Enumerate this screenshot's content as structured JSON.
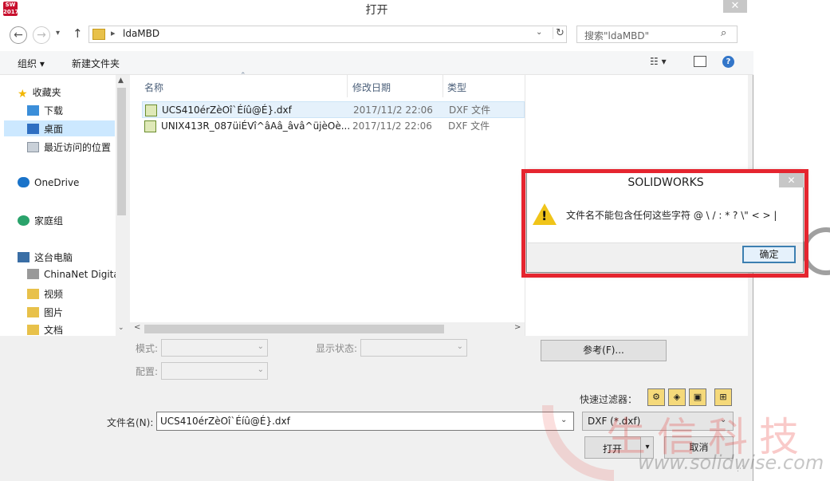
{
  "window": {
    "app_badge": "SW 2017",
    "title": "打开",
    "close": "✕"
  },
  "nav": {
    "back": "←",
    "forward": "→",
    "recent": "▾",
    "up": "↑"
  },
  "address": {
    "separator": "▸",
    "path": "ldaMBD",
    "drop": "⌄",
    "refresh": "↻"
  },
  "search": {
    "placeholder": "搜索\"ldaMBD\"",
    "icon": "⌕"
  },
  "toolbar": {
    "organize": "组织 ▾",
    "new_folder": "新建文件夹",
    "view": "☷ ▾",
    "help": "?"
  },
  "sidebar": {
    "items": [
      {
        "label": "收藏夹",
        "icon": "star-icon",
        "color": "#f2b600"
      },
      {
        "label": "下载",
        "icon": "download-icon",
        "color": "#3b8ed9"
      },
      {
        "label": "桌面",
        "icon": "desktop-icon",
        "color": "#2f6fc2"
      },
      {
        "label": "最近访问的位置",
        "icon": "recent-places-icon",
        "color": "#9aa4b0"
      },
      {
        "label": "OneDrive",
        "icon": "cloud-icon",
        "color": "#1a73c9"
      },
      {
        "label": "家庭组",
        "icon": "homegroup-icon",
        "color": "#2aa36b"
      },
      {
        "label": "这台电脑",
        "icon": "computer-icon",
        "color": "#3a6ea5"
      },
      {
        "label": "ChinaNet Digita",
        "icon": "network-device-icon",
        "color": "#777777"
      },
      {
        "label": "视频",
        "icon": "videos-folder-icon",
        "color": "#e8c14a"
      },
      {
        "label": "图片",
        "icon": "pictures-folder-icon",
        "color": "#e8c14a"
      },
      {
        "label": "文档",
        "icon": "documents-folder-icon",
        "color": "#e8c14a"
      }
    ],
    "scroll_up": "▲",
    "scroll_down": "⌄"
  },
  "files": {
    "columns": [
      "名称",
      "修改日期",
      "类型"
    ],
    "sort_arrow": "⌃",
    "rows": [
      {
        "name": "UCS410érZèOî`Éíû@É}.dxf",
        "date": "2017/11/2 22:06",
        "type": "DXF 文件"
      },
      {
        "name": "UNIX413R_087üiÉVî^âAâ_âvâ^üjèOè...",
        "date": "2017/11/2 22:06",
        "type": "DXF 文件"
      }
    ],
    "scroll_left": "<",
    "scroll_right": ">"
  },
  "options": {
    "mode_label": "模式:",
    "display_state_label": "显示状态:",
    "config_label": "配置:",
    "combo_arrow": "⌄",
    "reference_button": "参考(F)...",
    "quick_filter_label": "快速过滤器：",
    "quick_filters": [
      "⚙",
      "◈",
      "▣",
      "⊞"
    ]
  },
  "filename": {
    "label": "文件名(N):",
    "value": "UCS410érZèOî`Éíû@É}.dxf",
    "drop": "⌄"
  },
  "filetype": {
    "value": "DXF (*.dxf)",
    "drop": "⌄"
  },
  "buttons": {
    "open": "打开",
    "open_split": "▾",
    "cancel": "取消",
    "grip": "⋰"
  },
  "message_box": {
    "title": "SOLIDWORKS",
    "close": "✕",
    "icon": "warning-icon",
    "icon_mark": "!",
    "text": "文件名不能包含任何这些字符 @ \\ / : * ? \\\" < > |",
    "ok": "确定"
  },
  "watermark": {
    "text": "生信科技",
    "url": "www.solidwise.com"
  },
  "colors": {
    "highlight": "#e5252f",
    "accent": "#3c7fb1",
    "selection": "#e5f1fb"
  }
}
